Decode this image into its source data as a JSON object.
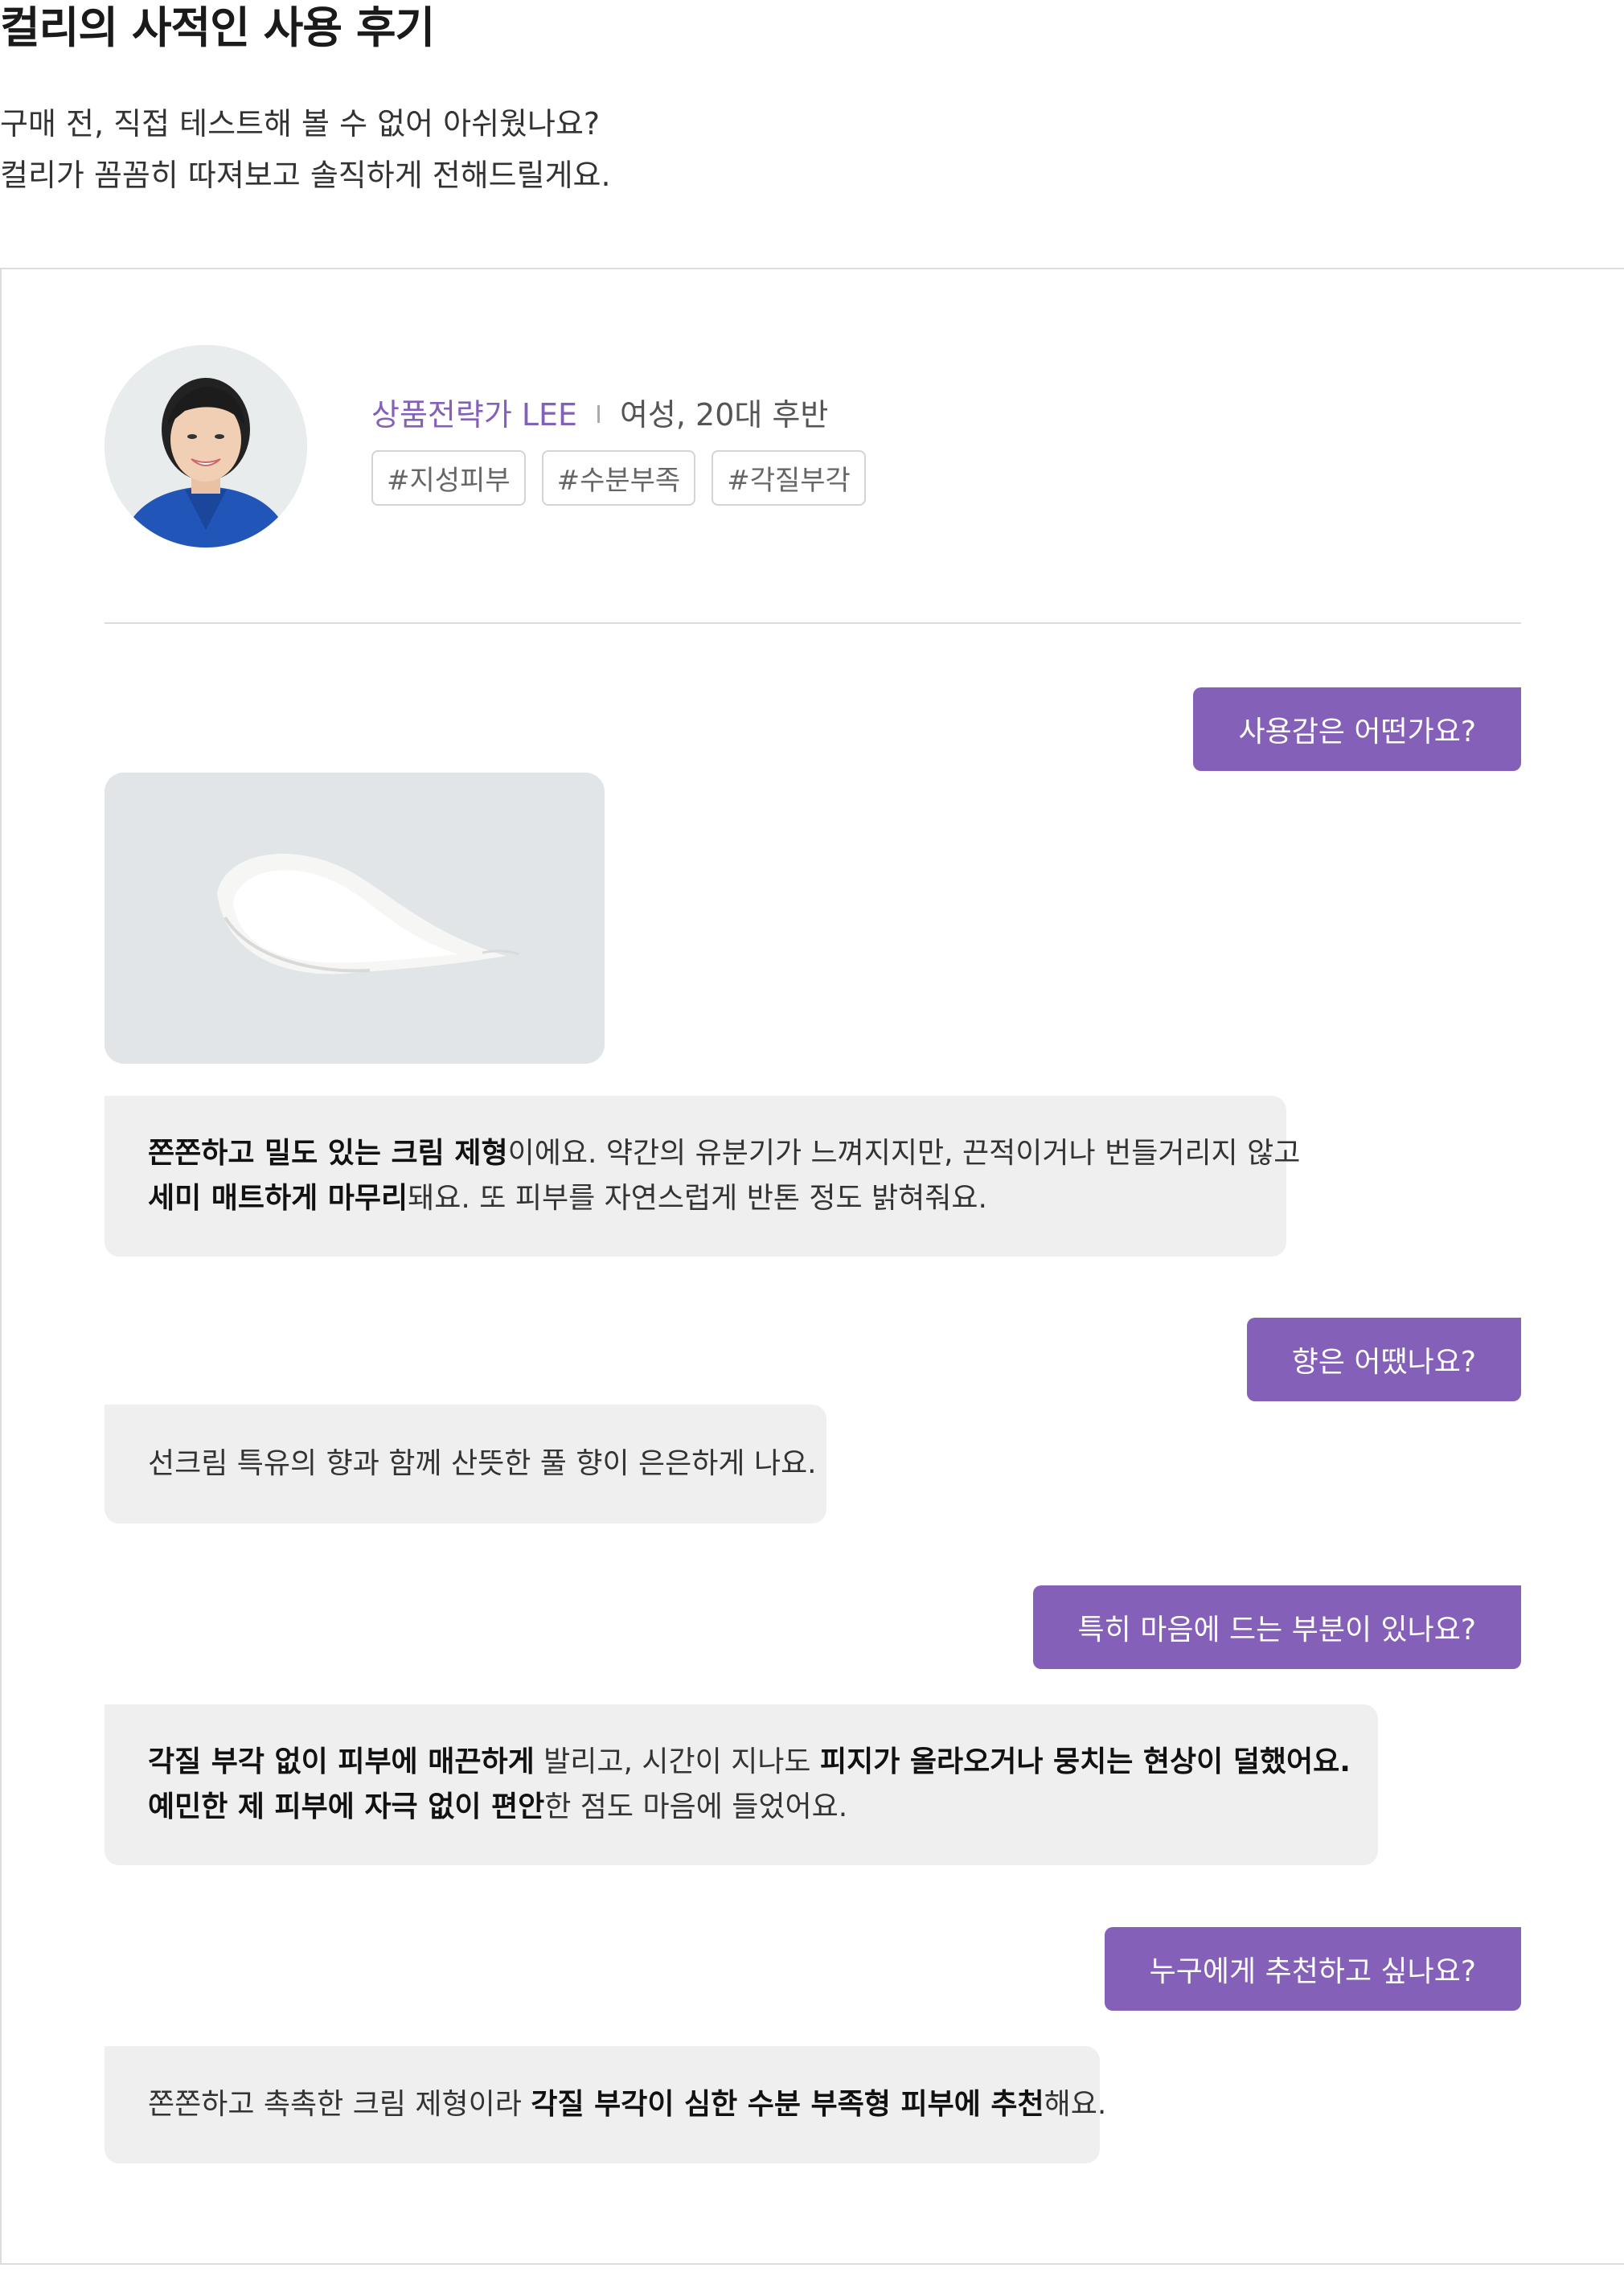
{
  "header": {
    "title": "컬리의 사적인 사용 후기",
    "intro_line1": "구매 전, 직접 테스트해 볼 수 없어 아쉬웠나요?",
    "intro_line2": "컬리가 꼼꼼히 따져보고 솔직하게 전해드릴게요."
  },
  "reviewer": {
    "role": "상품전략가 LEE",
    "separator": "I",
    "profile": "여성, 20대 후반",
    "tags": [
      "#지성피부",
      "#수분부족",
      "#각질부각"
    ]
  },
  "qa": [
    {
      "question": "사용감은 어떤가요?",
      "answer_lines": [
        [
          {
            "text": "쫀쫀하고 밀도 있는 크림 제형",
            "bold": true
          },
          {
            "text": "이에요. 약간의 유분기가 느껴지지만, 끈적이거나 번들거리지 않고",
            "bold": false
          }
        ],
        [
          {
            "text": "세미 매트하게 마무리",
            "bold": true
          },
          {
            "text": "돼요. 또 피부를 자연스럽게 반톤 정도 밝혀줘요.",
            "bold": false
          }
        ]
      ]
    },
    {
      "question": "향은 어땠나요?",
      "answer_lines": [
        [
          {
            "text": "선크림 특유의 향과 함께 산뜻한 풀 향이 은은하게 나요.",
            "bold": false
          }
        ]
      ]
    },
    {
      "question": "특히 마음에 드는 부분이 있나요?",
      "answer_lines": [
        [
          {
            "text": "각질 부각 없이 피부에 매끈하게",
            "bold": true
          },
          {
            "text": " 발리고, 시간이 지나도 ",
            "bold": false
          },
          {
            "text": "피지가 올라오거나 뭉치는 현상이 덜했어요.",
            "bold": true
          }
        ],
        [
          {
            "text": "예민한 제 피부에 자극 없이 편안",
            "bold": true
          },
          {
            "text": "한 점도 마음에 들었어요.",
            "bold": false
          }
        ]
      ]
    },
    {
      "question": "누구에게 추천하고 싶나요?",
      "answer_lines": [
        [
          {
            "text": "쫀쫀하고 촉촉한 크림 제형이라 ",
            "bold": false
          },
          {
            "text": "각질 부각이 심한 수분 부족형 피부에 추천",
            "bold": true
          },
          {
            "text": "해요.",
            "bold": false
          }
        ]
      ]
    }
  ],
  "colors": {
    "accent": "#8560b8",
    "answer_bg": "#efefef",
    "divider": "#dcdcdc"
  }
}
